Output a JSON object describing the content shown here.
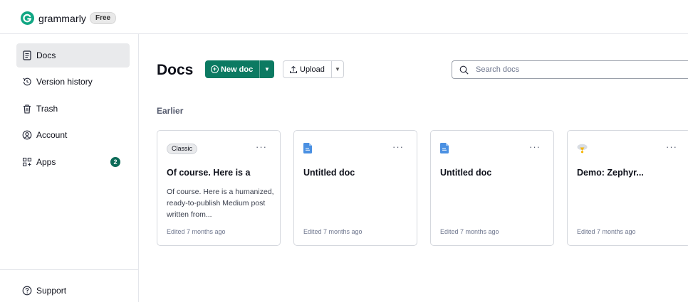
{
  "header": {
    "brand": "grammarly",
    "plan_badge": "Free"
  },
  "sidebar": {
    "items": [
      {
        "label": "Docs",
        "icon": "docs-icon",
        "active": true
      },
      {
        "label": "Version history",
        "icon": "history-icon"
      },
      {
        "label": "Trash",
        "icon": "trash-icon"
      },
      {
        "label": "Account",
        "icon": "account-icon"
      },
      {
        "label": "Apps",
        "icon": "apps-icon",
        "badge": "2"
      }
    ],
    "footer": {
      "label": "Support",
      "icon": "help-icon"
    }
  },
  "main": {
    "title": "Docs",
    "new_doc_label": "New doc",
    "upload_label": "Upload",
    "search_placeholder": "Search docs",
    "section_title": "Earlier",
    "more_label": "···",
    "cards": [
      {
        "tag": "Classic",
        "title": "Of course. Here is a",
        "snippet": "Of course. Here is a humanized, ready-to-publish Medium post written from...",
        "edited": "Edited 7 months ago",
        "icon": "none"
      },
      {
        "title": "Untitled doc",
        "edited": "Edited 7 months ago",
        "icon": "document-icon"
      },
      {
        "title": "Untitled doc",
        "edited": "Edited 7 months ago",
        "icon": "document-icon"
      },
      {
        "title": "Demo: Zephyr...",
        "edited": "Edited 7 months ago",
        "icon": "demo-icon"
      }
    ]
  },
  "colors": {
    "brand_green": "#0c7a62",
    "badge_green": "#0c6b58",
    "active_bg": "#e9eaec"
  }
}
